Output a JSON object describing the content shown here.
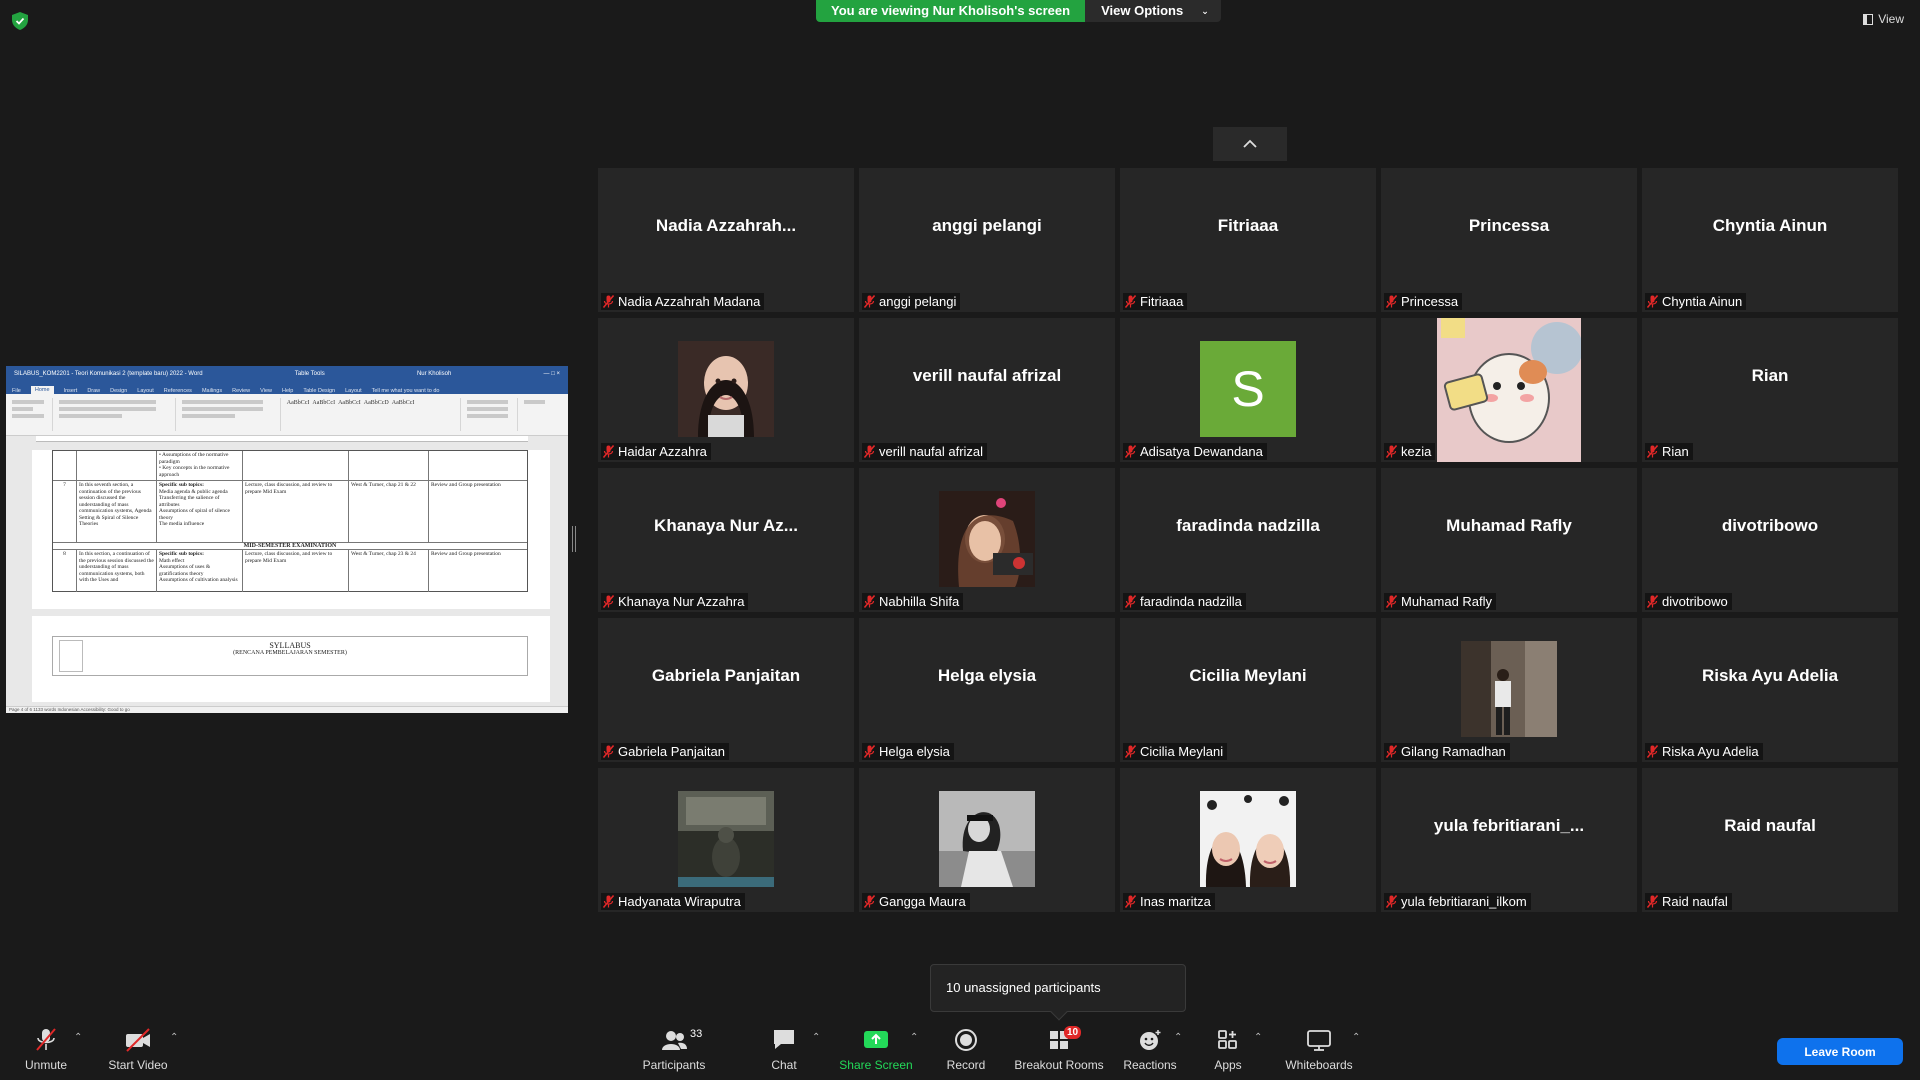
{
  "banner": {
    "viewing_text": "You are viewing Nur Kholisoh's screen",
    "view_options_label": "View Options",
    "view_label": "View"
  },
  "shared_screen": {
    "window_title": "SILABUS_KOM2201 - Teori Komunikasi 2 (template baru) 2022 - Word",
    "table_tools": "Table Tools",
    "user": "Nur Kholisoh",
    "tabs": [
      "File",
      "Home",
      "Insert",
      "Draw",
      "Design",
      "Layout",
      "References",
      "Mailings",
      "Review",
      "View",
      "Help",
      "Table Design",
      "Layout"
    ],
    "active_tab": "Home",
    "tell_me": "Tell me what you want to do",
    "styles": [
      "AaBbCcI",
      "AaBbCcI",
      "AaBbCcI",
      "AaBbCcD",
      "AaBbCcI"
    ],
    "row7": {
      "week": "7",
      "desc": "In this seventh section, a continuation of the previous session discussed the understanding of mass communication systems, Agenda Setting & Spiral of Silence Theories",
      "topics_head": "Specific sub topics:",
      "topics": [
        "Media agenda & public agenda",
        "Transferring the salience of attributes",
        "Assumptions of spiral of silence theory",
        "The media influence"
      ],
      "method": "Lecture, class discussion, and review to prepare Mid Exam",
      "ref": "West & Turner, chap 21 & 22",
      "assess": "Review and Group presentation"
    },
    "mid_exam": "MID-SEMESTER EXAMINATION",
    "row8": {
      "week": "8",
      "desc": "In this section, a continuation of the previous session discussed the understanding of mass communication systems, both with the Uses and",
      "topics_head": "Specific sub topics:",
      "topics": [
        "Math effect",
        "Assumptions of uses & gratifications theory",
        "Assumptions of cultivation analysis"
      ],
      "method": "Lecture, class discussion, and review to prepare Mid Exam",
      "ref": "West & Turner, chap 23 & 24",
      "assess": "Review and Group presentation"
    },
    "syllabus_title": "SYLLABUS",
    "syllabus_sub": "(RENCANA PEMBELAJARAN SEMESTER)",
    "status": "Page 4 of 6   1133 words   Indonesian   Accessibility: Good to go"
  },
  "participants": [
    {
      "big": "Nadia  Azzahrah...",
      "name": "Nadia Azzahrah Madana",
      "photo": null
    },
    {
      "big": "anggi pelangi",
      "name": "anggi pelangi",
      "photo": null
    },
    {
      "big": "Fitriaaa",
      "name": "Fitriaaa",
      "photo": null
    },
    {
      "big": "Princessa",
      "name": "Princessa",
      "photo": null
    },
    {
      "big": "Chyntia Ainun",
      "name": "Chyntia Ainun",
      "photo": null
    },
    {
      "big": "",
      "name": "Haidar Azzahra",
      "photo": "portrait-girl"
    },
    {
      "big": "verill naufal afrizal",
      "name": "verill naufal afrizal",
      "photo": null
    },
    {
      "big": "",
      "name": "Adisatya Dewandana",
      "photo": "avatar-letter",
      "letter": "S"
    },
    {
      "big": "",
      "name": "kezia",
      "photo": "hamster-cartoon"
    },
    {
      "big": "Rian",
      "name": "Rian",
      "photo": null
    },
    {
      "big": "Khanaya  Nur  Az...",
      "name": "Khanaya Nur Azzahra",
      "photo": null
    },
    {
      "big": "",
      "name": "Nabhilla Shifa",
      "photo": "portrait-flower"
    },
    {
      "big": "faradinda nadzilla",
      "name": "faradinda nadzilla",
      "photo": null
    },
    {
      "big": "Muhamad Rafly",
      "name": "Muhamad Rafly",
      "photo": null
    },
    {
      "big": "divotribowo",
      "name": "divotribowo",
      "photo": null
    },
    {
      "big": "Gabriela Panjaitan",
      "name": "Gabriela Panjaitan",
      "photo": null
    },
    {
      "big": "Helga elysia",
      "name": "Helga elysia",
      "photo": null
    },
    {
      "big": "Cicilia Meylani",
      "name": "Cicilia Meylani",
      "photo": null
    },
    {
      "big": "",
      "name": "Gilang Ramadhan",
      "photo": "man-standing"
    },
    {
      "big": "Riska Ayu Adelia",
      "name": "Riska Ayu Adelia",
      "photo": null
    },
    {
      "big": "",
      "name": "Hadyanata Wiraputra",
      "photo": "dark-scene"
    },
    {
      "big": "",
      "name": "Gangga Maura",
      "photo": "bw-portrait"
    },
    {
      "big": "",
      "name": "Inas maritza",
      "photo": "two-girls"
    },
    {
      "big": "yula  febritiarani_...",
      "name": "yula febritiarani_ilkom",
      "photo": null
    },
    {
      "big": "Raid naufal",
      "name": "Raid naufal",
      "photo": null
    }
  ],
  "unassigned": "10 unassigned participants",
  "toolbar": {
    "unmute": "Unmute",
    "start_video": "Start Video",
    "participants": "Participants",
    "participants_count": "33",
    "chat": "Chat",
    "share_screen": "Share Screen",
    "record": "Record",
    "breakout_rooms": "Breakout Rooms",
    "breakout_badge": "10",
    "reactions": "Reactions",
    "apps": "Apps",
    "whiteboards": "Whiteboards",
    "leave": "Leave Room"
  },
  "colors": {
    "banner_green": "#23a340",
    "share_green": "#23d959",
    "leave_blue": "#0e72ed",
    "muted_red": "#e02828",
    "avatar_green": "#6aaa38"
  }
}
